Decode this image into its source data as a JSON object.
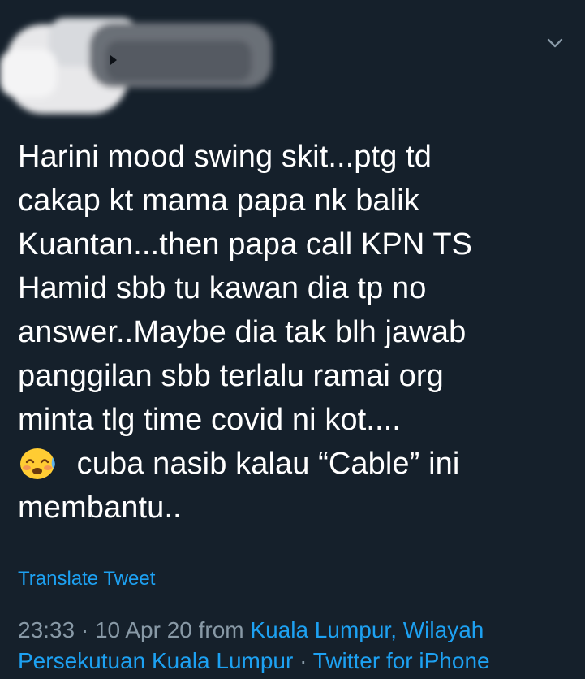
{
  "tweet": {
    "text_lines": [
      "Harini mood swing skit...ptg td",
      "cakap kt mama papa nk balik",
      "Kuantan...then papa call KPN TS",
      "Hamid sbb tu kawan dia tp no",
      "answer..Maybe dia tak blh jawab",
      "panggilan sbb terlalu ramai org",
      "minta tlg time covid ni kot...."
    ],
    "line_with_emoji": " cuba nasib kalau “Cable” ini",
    "last_line": "membantu..",
    "emoji_name": "pleading-face-icon",
    "translate_label": "Translate Tweet",
    "time": "23:33",
    "separator": " · ",
    "date": "10 Apr 20",
    "from_word": " from ",
    "location_line1": "Kuala Lumpur, Wilayah",
    "location_line2": "Persekutuan Kuala Lumpur",
    "source": "Twitter for iPhone"
  },
  "colors": {
    "background": "#15202b",
    "text": "#ffffff",
    "muted": "#8899a6",
    "link": "#1da1f2"
  }
}
